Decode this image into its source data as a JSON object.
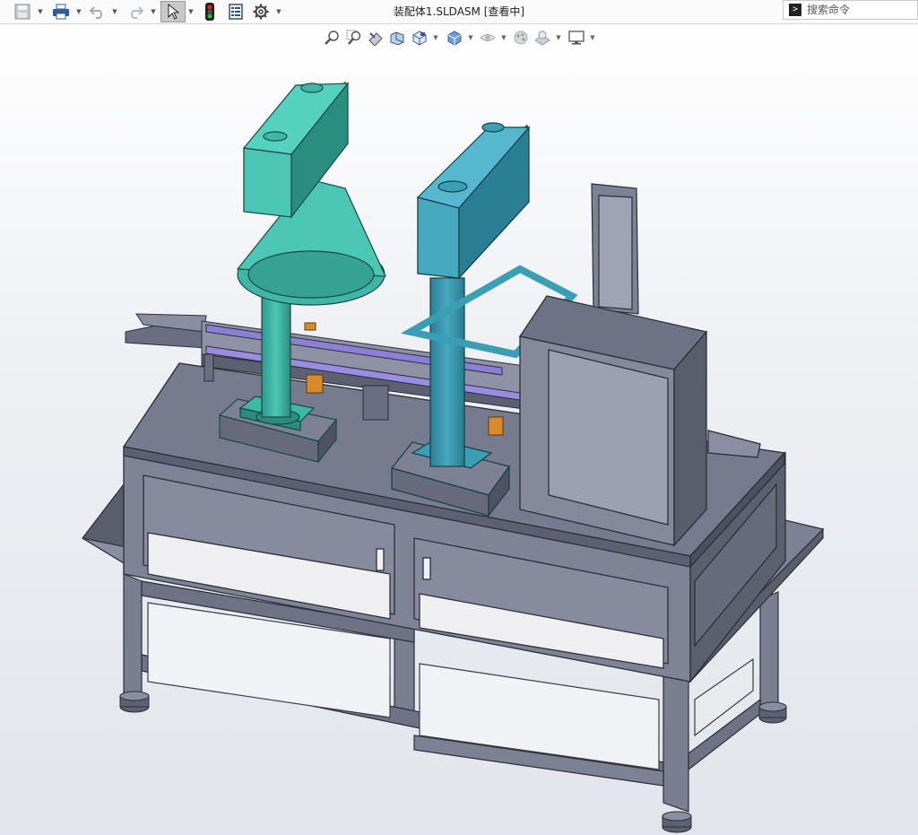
{
  "titlebar": {
    "document_title": "装配体1.SLDASM [查看中]",
    "search": {
      "placeholder": "搜索命令",
      "value": ""
    }
  },
  "quick_access": [
    {
      "icon": "save-icon"
    },
    {
      "icon": "print-icon"
    },
    {
      "icon": "undo-icon"
    },
    {
      "icon": "redo-icon"
    },
    {
      "icon": "select-icon"
    },
    {
      "icon": "traffic-light-icon"
    },
    {
      "icon": "file-properties-icon"
    },
    {
      "icon": "gear-icon"
    }
  ],
  "heads_up_toolbar": [
    {
      "icon": "zoom-to-fit-icon"
    },
    {
      "icon": "zoom-to-area-icon"
    },
    {
      "icon": "previous-view-icon"
    },
    {
      "icon": "section-view-icon"
    },
    {
      "icon": "view-orientation-icon"
    },
    {
      "icon": "display-style-icon"
    },
    {
      "icon": "hide-show-items-icon"
    },
    {
      "icon": "edit-appearance-icon"
    },
    {
      "icon": "apply-scene-icon"
    },
    {
      "icon": "view-settings-icon"
    }
  ],
  "colors": {
    "frame": "#6e7284",
    "frame_dark": "#4d5060",
    "teal_left": "#3fb6a6",
    "teal_right": "#3a9fb5",
    "conveyor_accent": "#8e7fd6"
  }
}
